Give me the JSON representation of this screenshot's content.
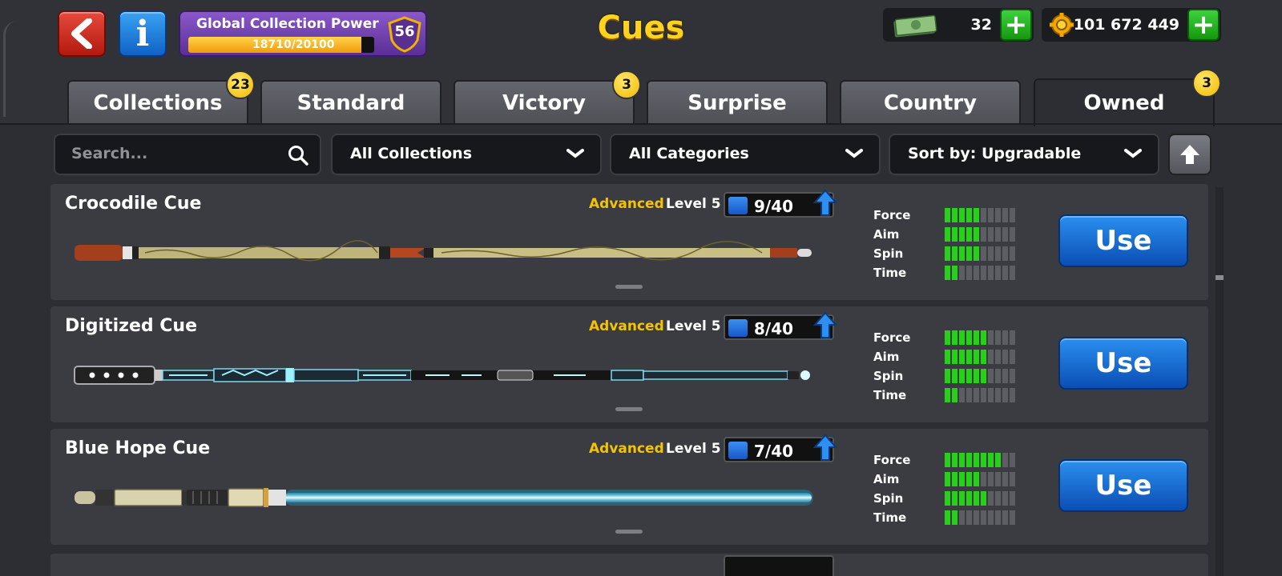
{
  "header": {
    "title": "Cues",
    "collection_power": {
      "label": "Global Collection Power",
      "value_text": "18710/20100",
      "progress": 0.93,
      "level": "56"
    },
    "currencies": [
      {
        "icon": "cash-icon",
        "value": "32"
      },
      {
        "icon": "coins-icon",
        "value": "101 672 449"
      }
    ]
  },
  "tabs": [
    {
      "label": "Collections",
      "badge": "23"
    },
    {
      "label": "Standard",
      "badge": ""
    },
    {
      "label": "Victory",
      "badge": "3"
    },
    {
      "label": "Surprise",
      "badge": ""
    },
    {
      "label": "Country",
      "badge": ""
    },
    {
      "label": "Owned",
      "badge": "3",
      "active": true
    }
  ],
  "filters": {
    "search_placeholder": "Search...",
    "collection": "All Collections",
    "category": "All Categories",
    "sort": "Sort by: Upgradable"
  },
  "stat_labels": {
    "force": "Force",
    "aim": "Aim",
    "spin": "Spin",
    "time": "Time"
  },
  "cues": [
    {
      "name": "Crocodile Cue",
      "tier": "Advanced",
      "level": "Level 5",
      "progress": "9/40",
      "stats": {
        "force": 5,
        "aim": 5,
        "spin": 5,
        "time": 2
      },
      "button": "Use"
    },
    {
      "name": "Digitized Cue",
      "tier": "Advanced",
      "level": "Level 5",
      "progress": "8/40",
      "stats": {
        "force": 6,
        "aim": 6,
        "spin": 6,
        "time": 2
      },
      "button": "Use"
    },
    {
      "name": "Blue Hope Cue",
      "tier": "Advanced",
      "level": "Level 5",
      "progress": "7/40",
      "stats": {
        "force": 8,
        "aim": 5,
        "spin": 6,
        "time": 2
      },
      "button": "Use"
    }
  ],
  "colors": {
    "accent_yellow": "#ffd21f",
    "stat_on": "#27d11a",
    "use_button": "#1a6fdc"
  }
}
